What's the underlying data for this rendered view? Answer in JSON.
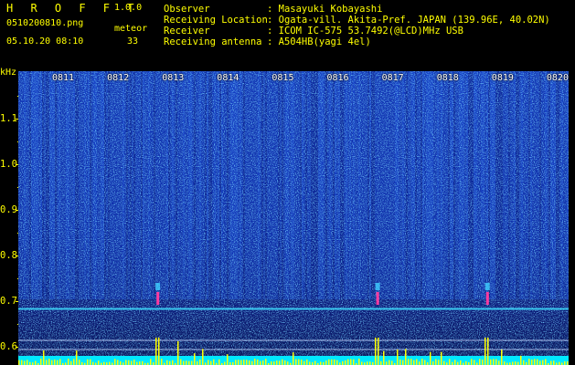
{
  "app": {
    "name": "H R O F F T",
    "version": "1.0.0"
  },
  "file": {
    "name": "0510200810.png",
    "datetime": "05.10.20 08:10"
  },
  "meteor": {
    "label": "meteor",
    "count": "33"
  },
  "info": [
    {
      "key": "Observer",
      "value": ": Masayuki Kobayashi"
    },
    {
      "key": "Receiving Location",
      "value": ": Ogata-vill. Akita-Pref. JAPAN (139.96E, 40.02N)"
    },
    {
      "key": "Receiver",
      "value": ": ICOM IC-575 53.7492(@LCD)MHz USB"
    },
    {
      "key": "Receiving antenna",
      "value": ": A504HB(yagi 4el)"
    }
  ],
  "chart_data": {
    "type": "heatmap",
    "ylabel": "kHz",
    "y_ticks": [
      "1.1",
      "1.0",
      "0.9",
      "0.8",
      "0.7",
      "0.6"
    ],
    "y_values": [
      1.1,
      1.0,
      0.9,
      0.8,
      0.7,
      0.6
    ],
    "x_ticks": [
      "0811",
      "0812",
      "0813",
      "0814",
      "0815",
      "0816",
      "0817",
      "0818",
      "0819",
      "0820"
    ],
    "carrier_khz": 0.685,
    "meteor_pings_at_x": [
      "0813",
      "0817",
      "0819"
    ],
    "colors": {
      "background": "#0a1a8c",
      "noise_hi": "#3fd0ff",
      "carrier": "#40e0ff",
      "ping": "#ff3aa0",
      "baseline": "#00e8ff",
      "bars": "#ffff00"
    }
  }
}
